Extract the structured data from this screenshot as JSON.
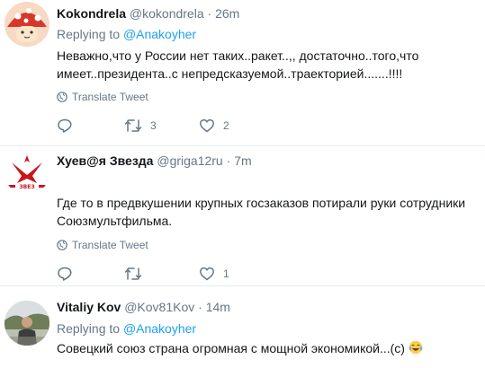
{
  "colors": {
    "link": "#1da1f2",
    "secondary": "#657786",
    "primary": "#14171a",
    "divider": "#e6ecf0"
  },
  "tweets": [
    {
      "name": "Kokondrela",
      "handle": "@kokondrela",
      "dot": "·",
      "time": "26m",
      "replying_prefix": "Replying to",
      "replying_to": "@Anakoyher",
      "text": "Неважно,что у России нет таких..ракет..,, достаточно..того,что имеет..президента..с непредсказуемой..траекторией.......!!!!",
      "translate": "Translate Tweet",
      "reply_count": "",
      "retweet_count": "3",
      "like_count": "2",
      "avatar_icon": "mushroom-avatar"
    },
    {
      "name": "Хуев@я Звезда",
      "handle": "@griga12ru",
      "dot": "·",
      "time": "7m",
      "replying_prefix": "",
      "replying_to": "",
      "text": "Где то в предвкушении крупных госзаказов потирали руки сотрудники Союзмультфильма.",
      "translate": "Translate Tweet",
      "reply_count": "",
      "retweet_count": "",
      "like_count": "1",
      "avatar_icon": "red-star-logo",
      "avatar_caption": "ЗВЕЗ"
    },
    {
      "name": "Vitaliy Kov",
      "handle": "@Kov81Kov",
      "dot": "·",
      "time": "14m",
      "replying_prefix": "Replying to",
      "replying_to": "@Anakoyher",
      "text": "Совецкий союз страна огромная с мощной экономикой...(с)",
      "emoji": "tears-of-joy-emoji",
      "avatar_icon": "person-photo-avatar"
    }
  ]
}
